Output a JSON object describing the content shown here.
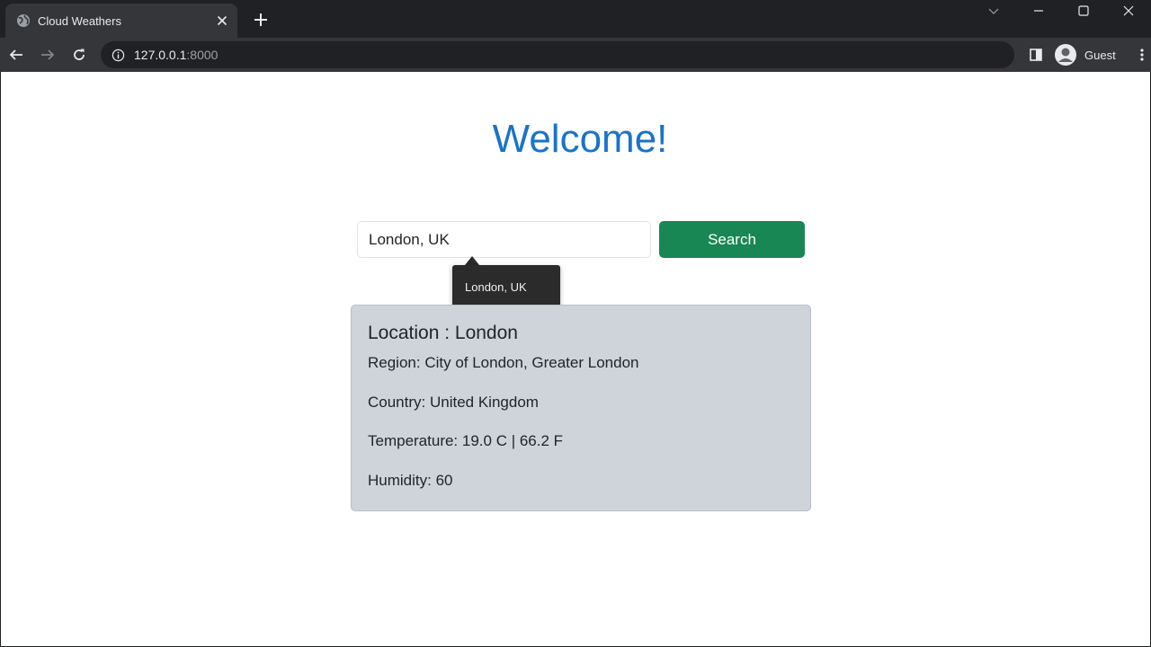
{
  "browser": {
    "tab_title": "Cloud Weathers",
    "url_host": "127.0.0.1",
    "url_port": ":8000",
    "profile_label": "Guest"
  },
  "page": {
    "heading": "Welcome!",
    "search": {
      "value": "London, UK",
      "button_label": "Search",
      "autocomplete_suggestion": "London, UK"
    },
    "weather": {
      "location": "Location : London",
      "region": "Region: City of London, Greater London",
      "country": "Country: United Kingdom",
      "temperature": "Temperature: 19.0 C | 66.2 F",
      "humidity": "Humidity: 60"
    }
  },
  "colors": {
    "heading": "#1a73c9",
    "search_button": "#198754",
    "card_background": "#ced4da"
  },
  "icons": {
    "tab_favicon": "globe-icon",
    "tab_close": "close-icon",
    "new_tab": "plus-icon",
    "back": "arrow-left-icon",
    "forward": "arrow-right-icon",
    "reload": "reload-icon",
    "site_info": "info-icon",
    "side_panel": "side-panel-icon",
    "profile": "avatar-icon",
    "menu": "kebab-menu-icon"
  }
}
